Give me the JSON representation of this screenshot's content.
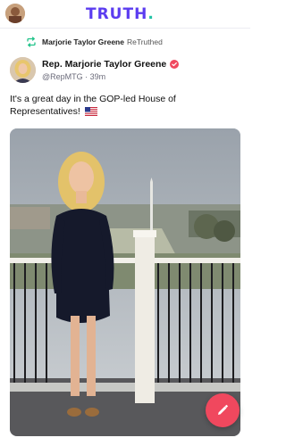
{
  "header": {
    "logo_main": "TRUTH",
    "logo_dot": "."
  },
  "retruth": {
    "user": "Marjorie Taylor Greene",
    "action": "ReTruthed"
  },
  "post": {
    "author_name": "Rep. Marjorie Taylor Greene",
    "handle": "@RepMTG",
    "separator": " · ",
    "time": "39m",
    "text": "It's a great day in the GOP-led House of Representatives!",
    "emoji_icon": "us-flag-icon"
  },
  "icons": {
    "retruth": "retruth-icon",
    "verified": "verified-badge-icon",
    "compose": "compose-pencil-icon"
  },
  "colors": {
    "brand": "#5b3cf0",
    "brand_dot": "#22c3a6",
    "retruth_icon": "#22c38a",
    "verified_badge": "#f0485e",
    "fab": "#f0485e"
  }
}
